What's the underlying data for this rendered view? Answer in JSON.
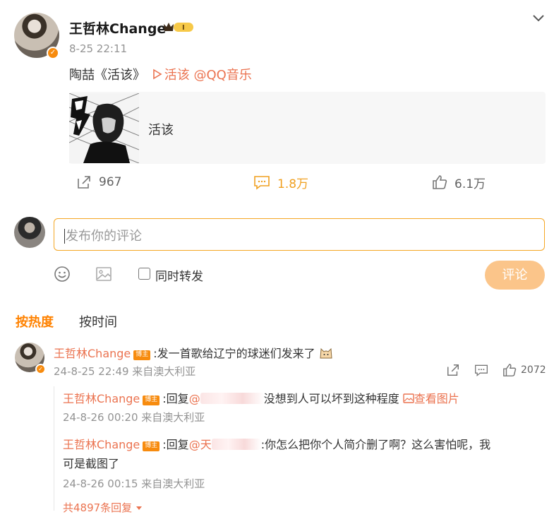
{
  "post": {
    "author": "王哲林Change",
    "time": "8-25 22:11",
    "text_prefix": "陶喆《活该》",
    "music_link": "活该",
    "mention": "@QQ音乐",
    "card_title": "活该",
    "actions": {
      "share_count": "967",
      "comment_count": "1.8万",
      "like_count": "6.1万"
    },
    "level_badge": "I"
  },
  "composer": {
    "placeholder": "发布你的评论",
    "repost_label": "同时转发",
    "submit_label": "评论"
  },
  "sort": {
    "hot": "按热度",
    "time": "按时间"
  },
  "comment": {
    "author": "王哲林Change",
    "badge": "博主",
    "text": ":发一首歌给辽宁的球迷们发来了",
    "meta": "24-8-25 22:49 来自澳大利亚",
    "like_count": "2072",
    "replies": [
      {
        "author": "王哲林Change",
        "badge": "博主",
        "reply_prefix": ":回复",
        "mention": "@",
        "text": "没想到人可以坏到这种程度",
        "pic_link": "查看图片",
        "meta": "24-8-26 00:20 来自澳大利亚"
      },
      {
        "author": "王哲林Change",
        "badge": "博主",
        "reply_prefix": ":回复",
        "mention": "@天",
        "text": ":你怎么把你个人简介删了啊？这么害怕呢，我可是截图了",
        "meta": "24-8-26 00:15 来自澳大利亚"
      }
    ],
    "total_replies": "共4897条回复"
  },
  "colors": {
    "accent": "#ff8200",
    "link": "#eb7350",
    "focus_border": "#f5a623",
    "submit_bg": "#fbc58a"
  }
}
